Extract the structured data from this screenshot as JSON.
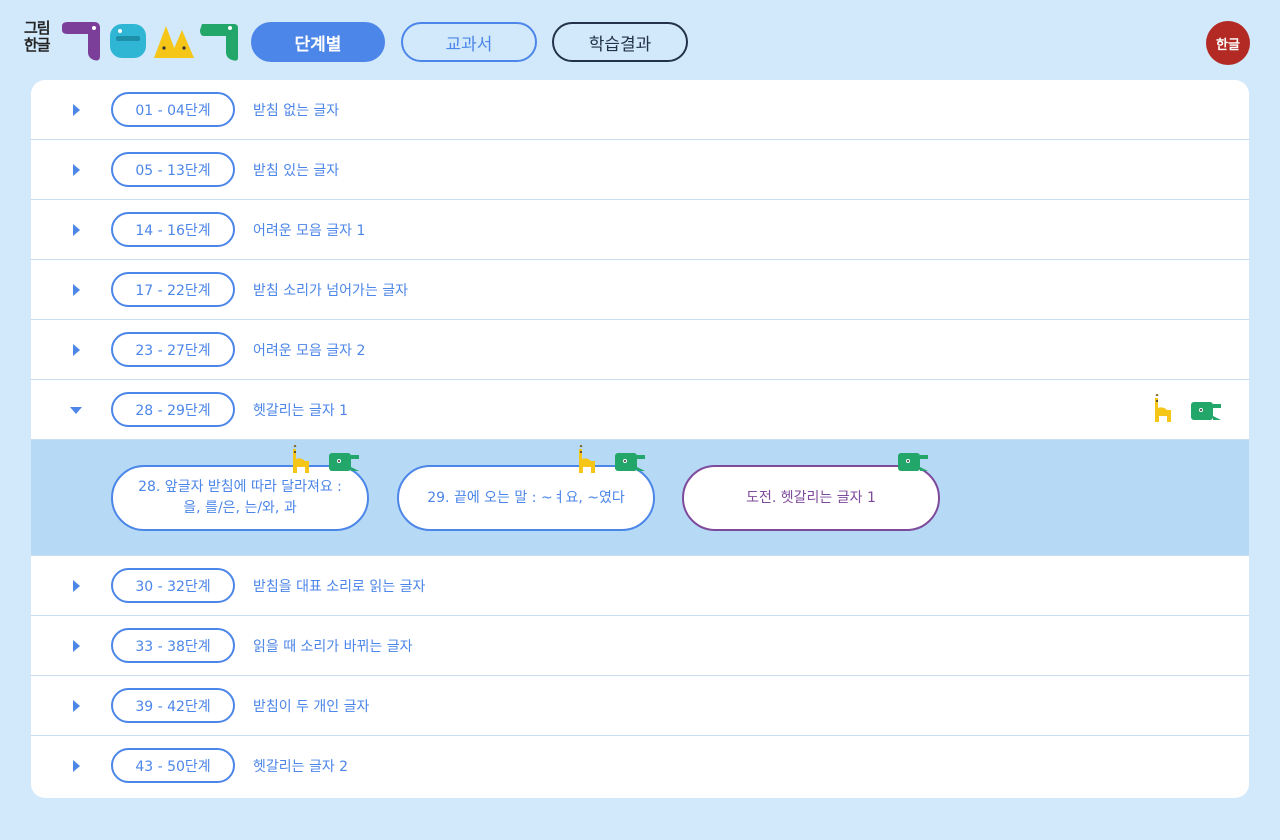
{
  "header": {
    "logo_text": "그림한글",
    "nav": {
      "by_stage": "단계별",
      "textbook": "교과서",
      "results": "학습결과"
    },
    "language_button": "한글"
  },
  "colors": {
    "accent": "#4c86e8",
    "dark": "#22324a",
    "challenge": "#7e4a9c",
    "expanded_bg": "#b6daf6",
    "page_bg": "#d2e9fb",
    "language_bg": "#b32a24"
  },
  "stages": [
    {
      "range": "01 - 04단계",
      "title": "받침 없는 글자",
      "expanded": false
    },
    {
      "range": "05 - 13단계",
      "title": "받침 있는 글자",
      "expanded": false
    },
    {
      "range": "14 - 16단계",
      "title": "어려운 모음 글자 1",
      "expanded": false
    },
    {
      "range": "17 - 22단계",
      "title": "받침 소리가 넘어가는 글자",
      "expanded": false
    },
    {
      "range": "23 - 27단계",
      "title": "어려운 모음 글자 2",
      "expanded": false
    },
    {
      "range": "28 - 29단계",
      "title": "헷갈리는 글자 1",
      "expanded": true,
      "status_icons": [
        "giraffe-character-icon",
        "crocodile-character-icon"
      ]
    },
    {
      "range": "30 - 32단계",
      "title": "받침을 대표 소리로 읽는 글자",
      "expanded": false
    },
    {
      "range": "33 - 38단계",
      "title": "읽을 때 소리가 바뀌는 글자",
      "expanded": false
    },
    {
      "range": "39 - 42단계",
      "title": "받침이 두 개인 글자",
      "expanded": false
    },
    {
      "range": "43 - 50단계",
      "title": "헷갈리는 글자 2",
      "expanded": false
    }
  ],
  "expanded_lessons": [
    {
      "line1": "28. 앞글자 받침에 따라 달라져요 :",
      "line2": "을, 를/은, 는/와, 과",
      "style": "blue",
      "icons": [
        "giraffe-character-icon",
        "crocodile-character-icon"
      ]
    },
    {
      "line1": "29. 끝에 오는 말 : ~ㅕ요, ~였다",
      "line2": "",
      "style": "blue",
      "icons": [
        "giraffe-character-icon",
        "crocodile-character-icon"
      ]
    },
    {
      "line1": "도전. 헷갈리는 글자 1",
      "line2": "",
      "style": "purple",
      "icons": [
        "crocodile-character-icon"
      ]
    }
  ]
}
